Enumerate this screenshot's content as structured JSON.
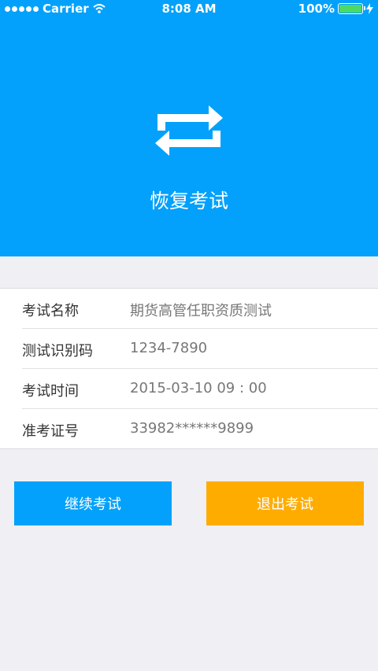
{
  "status_bar": {
    "carrier": "Carrier",
    "time": "8:08 AM",
    "battery": "100%"
  },
  "header": {
    "icon": "repeat-icon",
    "title": "恢复考试",
    "bg_color": "#03a1fb"
  },
  "info": {
    "rows": [
      {
        "label": "考试名称",
        "value": "期货高管任职资质测试"
      },
      {
        "label": "测试识别码",
        "value": "1234-7890"
      },
      {
        "label": "考试时间",
        "value": "2015-03-10  09 : 00"
      },
      {
        "label": "准考证号",
        "value": "33982******9899"
      }
    ]
  },
  "buttons": {
    "continue_label": "继续考试",
    "exit_label": "退出考试",
    "continue_color": "#03a1fb",
    "exit_color": "#ffac00"
  }
}
